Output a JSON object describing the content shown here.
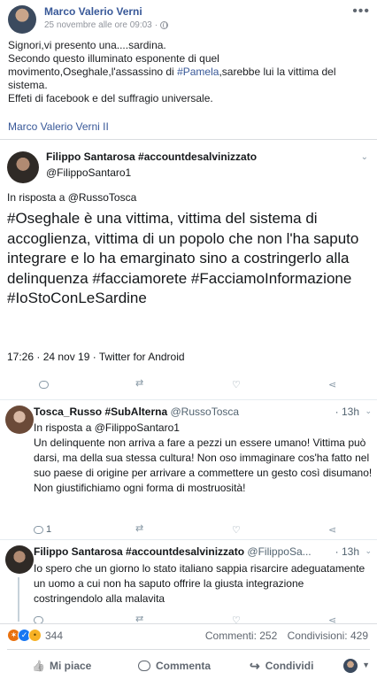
{
  "post": {
    "author": "Marco Valerio Verni",
    "timestamp": "25 novembre alle ore 09:03",
    "more": "•••",
    "lines": [
      "Signori,vi presento una....sardina.",
      "Secondo questo illuminato esponente di quel",
      "movimento,Oseghale,l'assassino di ",
      "#Pamela",
      ",sarebbe lui la vittima del sistema.",
      "Effeti di facebook e del suffragio universale."
    ],
    "signature": "Marco Valerio Verni II"
  },
  "main_tweet": {
    "name": "Filippo Santarosa #accountdesalvinizzato",
    "handle": "@FilippoSantaro1",
    "reply_to": "In risposta a @RussoTosca",
    "text": "#Oseghale è una vittima, vittima del sistema di accoglienza, vittima di un popolo che non l'ha saputo integrare e lo ha emarginato sino a costringerlo alla delinquenza #facciamorete #FacciamoInformazione #IoStoConLeSardine",
    "footer": "17:26 · 24 nov 19 · Twitter for Android"
  },
  "replies": [
    {
      "name": "Tosca_Russo #SubAlterna",
      "handle": "@RussoTosca",
      "time": "· 13h",
      "reply_to": "In risposta a @FilippoSantaro1",
      "text": "Un delinquente non arriva a fare a pezzi un essere umano! Vittima può darsi, ma della sua stessa cultura! Non oso immaginare cos'ha fatto nel suo paese di origine per arrivare a commettere un gesto così disumano! Non giustifichiamo ogni forma di mostruosità!",
      "reply_count": "1"
    },
    {
      "name": "Filippo Santarosa #accountdesalvinizzato",
      "handle": "@FilippoSa...",
      "time": "· 13h",
      "text": "Io spero che un giorno lo stato italiano sappia risarcire adeguatamente un uomo a cui non ha saputo offrire la giusta integrazione costringendolo alla malavita"
    }
  ],
  "footer": {
    "reaction_count": "344",
    "comments": "Commenti: 252",
    "shares": "Condivisioni: 429",
    "like_label": "Mi piace",
    "comment_label": "Commenta",
    "share_label": "Condividi"
  },
  "colors": {
    "fb_link": "#385898",
    "twitter_gray": "#8899a6",
    "divider": "#dadde1"
  }
}
